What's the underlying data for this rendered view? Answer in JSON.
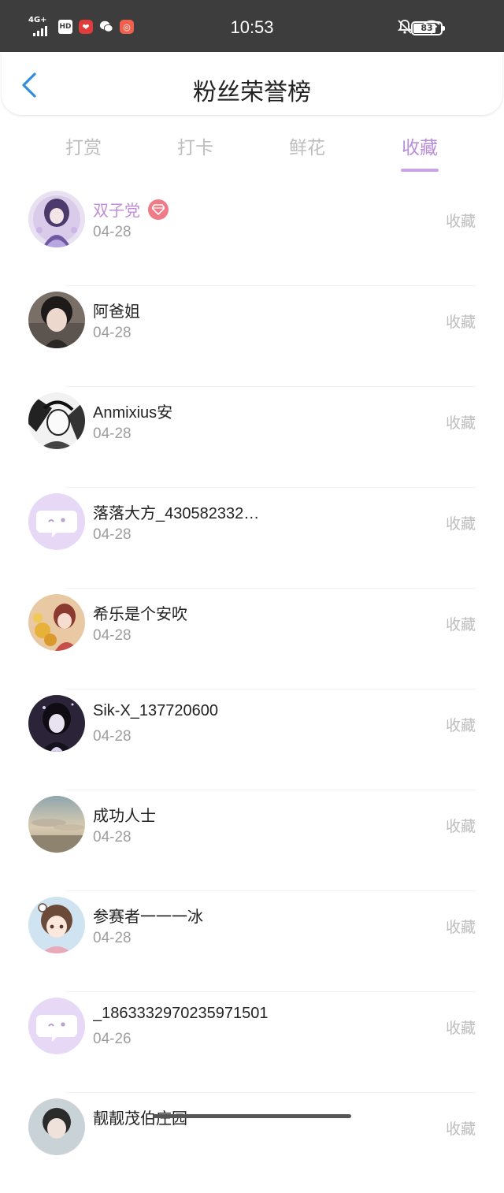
{
  "status_bar": {
    "network": "4G+",
    "hd": "HD",
    "time": "10:53",
    "battery": "83",
    "battery_level_percent": 83
  },
  "header": {
    "title": "粉丝荣誉榜"
  },
  "tabs": [
    {
      "label": "打赏",
      "active": false
    },
    {
      "label": "打卡",
      "active": false
    },
    {
      "label": "鲜花",
      "active": false
    },
    {
      "label": "收藏",
      "active": true
    }
  ],
  "fans": [
    {
      "name": "双子党",
      "date": "04-28",
      "action": "收藏",
      "vip": true
    },
    {
      "name": "阿爸姐",
      "date": "04-28",
      "action": "收藏"
    },
    {
      "name": "Anmixius安",
      "date": "04-28",
      "action": "收藏"
    },
    {
      "name": "落落大方_430582332…",
      "date": "04-28",
      "action": "收藏"
    },
    {
      "name": "希乐是个安吹",
      "date": "04-28",
      "action": "收藏"
    },
    {
      "name": "Sik-X_137720600",
      "date": "04-28",
      "action": "收藏"
    },
    {
      "name": "成功人士",
      "date": "04-28",
      "action": "收藏"
    },
    {
      "name": "参赛者一一一冰",
      "date": "04-28",
      "action": "收藏"
    },
    {
      "name": "_1863332970235971501",
      "date": "04-26",
      "action": "收藏"
    },
    {
      "name": "靓靓茂伯庄园",
      "date": "",
      "action": "收藏"
    }
  ],
  "colors": {
    "accent": "#b98ed9",
    "status_bar": "#3d3d3d",
    "back_arrow": "#2f8ee0"
  }
}
